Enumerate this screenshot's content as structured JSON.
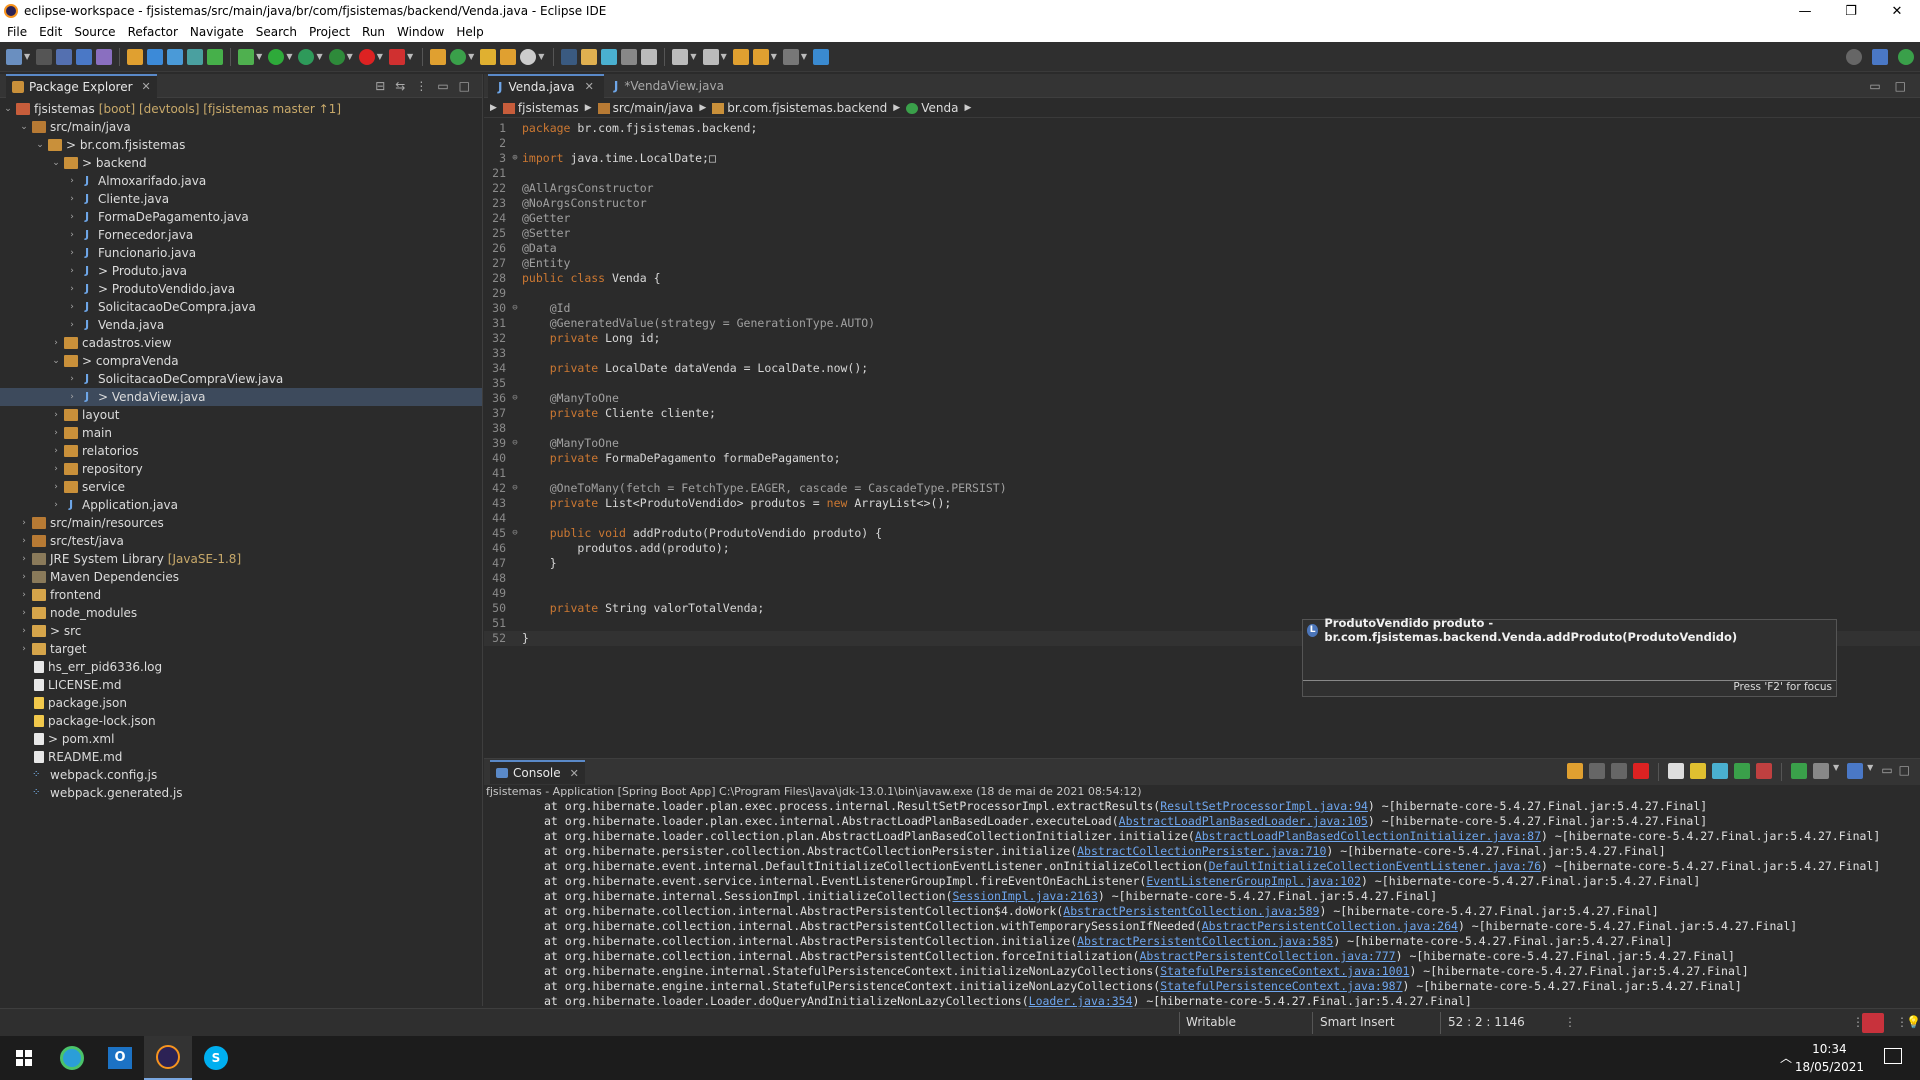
{
  "window": {
    "title": "eclipse-workspace - fjsistemas/src/main/java/br/com/fjsistemas/backend/Venda.java - Eclipse IDE"
  },
  "menu": [
    "File",
    "Edit",
    "Source",
    "Refactor",
    "Navigate",
    "Search",
    "Project",
    "Run",
    "Window",
    "Help"
  ],
  "explorer": {
    "tab_label": "Package Explorer",
    "items": [
      {
        "depth": 0,
        "twisty": "open",
        "icon": "project",
        "label": "fjsistemas",
        "deco": "[boot] [devtools] [fjsistemas master ↑1]"
      },
      {
        "depth": 1,
        "twisty": "open",
        "icon": "srcfolder",
        "label": "src/main/java",
        "deco": ""
      },
      {
        "depth": 2,
        "twisty": "open",
        "icon": "pkg",
        "label": "> br.com.fjsistemas",
        "deco": ""
      },
      {
        "depth": 3,
        "twisty": "open",
        "icon": "pkg",
        "label": "> backend",
        "deco": ""
      },
      {
        "depth": 4,
        "twisty": "closed",
        "icon": "java",
        "label": "Almoxarifado.java",
        "deco": ""
      },
      {
        "depth": 4,
        "twisty": "closed",
        "icon": "java",
        "label": "Cliente.java",
        "deco": ""
      },
      {
        "depth": 4,
        "twisty": "closed",
        "icon": "java",
        "label": "FormaDePagamento.java",
        "deco": ""
      },
      {
        "depth": 4,
        "twisty": "closed",
        "icon": "java",
        "label": "Fornecedor.java",
        "deco": ""
      },
      {
        "depth": 4,
        "twisty": "closed",
        "icon": "java",
        "label": "Funcionario.java",
        "deco": ""
      },
      {
        "depth": 4,
        "twisty": "closed",
        "icon": "java",
        "label": "> Produto.java",
        "deco": ""
      },
      {
        "depth": 4,
        "twisty": "closed",
        "icon": "java",
        "label": "> ProdutoVendido.java",
        "deco": ""
      },
      {
        "depth": 4,
        "twisty": "closed",
        "icon": "java",
        "label": "SolicitacaoDeCompra.java",
        "deco": ""
      },
      {
        "depth": 4,
        "twisty": "closed",
        "icon": "java",
        "label": "Venda.java",
        "deco": ""
      },
      {
        "depth": 3,
        "twisty": "closed",
        "icon": "pkg",
        "label": "cadastros.view",
        "deco": ""
      },
      {
        "depth": 3,
        "twisty": "open",
        "icon": "pkg",
        "label": "> compraVenda",
        "deco": ""
      },
      {
        "depth": 4,
        "twisty": "closed",
        "icon": "java",
        "label": "SolicitacaoDeCompraView.java",
        "deco": ""
      },
      {
        "depth": 4,
        "twisty": "closed",
        "icon": "java",
        "label": "> VendaView.java",
        "deco": "",
        "selected": true
      },
      {
        "depth": 3,
        "twisty": "closed",
        "icon": "pkg",
        "label": "layout",
        "deco": ""
      },
      {
        "depth": 3,
        "twisty": "closed",
        "icon": "pkg",
        "label": "main",
        "deco": ""
      },
      {
        "depth": 3,
        "twisty": "closed",
        "icon": "pkg",
        "label": "relatorios",
        "deco": ""
      },
      {
        "depth": 3,
        "twisty": "closed",
        "icon": "pkg",
        "label": "repository",
        "deco": ""
      },
      {
        "depth": 3,
        "twisty": "closed",
        "icon": "pkg",
        "label": "service",
        "deco": ""
      },
      {
        "depth": 3,
        "twisty": "closed",
        "icon": "java",
        "label": "Application.java",
        "deco": ""
      },
      {
        "depth": 1,
        "twisty": "closed",
        "icon": "srcfolder",
        "label": "src/main/resources",
        "deco": ""
      },
      {
        "depth": 1,
        "twisty": "closed",
        "icon": "srcfolder",
        "label": "src/test/java",
        "deco": ""
      },
      {
        "depth": 1,
        "twisty": "closed",
        "icon": "lib",
        "label": "JRE System Library",
        "deco": "[JavaSE-1.8]"
      },
      {
        "depth": 1,
        "twisty": "closed",
        "icon": "lib",
        "label": "Maven Dependencies",
        "deco": ""
      },
      {
        "depth": 1,
        "twisty": "closed",
        "icon": "folder",
        "label": "frontend",
        "deco": ""
      },
      {
        "depth": 1,
        "twisty": "closed",
        "icon": "folder",
        "label": "node_modules",
        "deco": ""
      },
      {
        "depth": 1,
        "twisty": "closed",
        "icon": "folder",
        "label": "> src",
        "deco": ""
      },
      {
        "depth": 1,
        "twisty": "closed",
        "icon": "folder",
        "label": "target",
        "deco": ""
      },
      {
        "depth": 1,
        "twisty": "none",
        "icon": "file",
        "label": "hs_err_pid6336.log",
        "deco": ""
      },
      {
        "depth": 1,
        "twisty": "none",
        "icon": "file",
        "label": "LICENSE.md",
        "deco": ""
      },
      {
        "depth": 1,
        "twisty": "none",
        "icon": "json",
        "label": "package.json",
        "deco": ""
      },
      {
        "depth": 1,
        "twisty": "none",
        "icon": "json",
        "label": "package-lock.json",
        "deco": ""
      },
      {
        "depth": 1,
        "twisty": "none",
        "icon": "file",
        "label": "> pom.xml",
        "deco": ""
      },
      {
        "depth": 1,
        "twisty": "none",
        "icon": "file",
        "label": "README.md",
        "deco": ""
      },
      {
        "depth": 1,
        "twisty": "none",
        "icon": "dots",
        "label": "webpack.config.js",
        "deco": ""
      },
      {
        "depth": 1,
        "twisty": "none",
        "icon": "dots",
        "label": "webpack.generated.js",
        "deco": ""
      }
    ]
  },
  "editor": {
    "tabs": [
      {
        "label": "Venda.java",
        "active": true
      },
      {
        "label": "*VendaView.java",
        "active": false
      }
    ],
    "breadcrumb": [
      "fjsistemas",
      "src/main/java",
      "br.com.fjsistemas.backend",
      "Venda"
    ],
    "lines": [
      {
        "n": "1",
        "fold": "",
        "text": "package br.com.fjsistemas.backend;"
      },
      {
        "n": "2",
        "fold": "",
        "text": ""
      },
      {
        "n": "3",
        "fold": "⊕",
        "text": "import java.time.LocalDate;□"
      },
      {
        "n": "21",
        "fold": "",
        "text": ""
      },
      {
        "n": "22",
        "fold": "",
        "text": "@AllArgsConstructor"
      },
      {
        "n": "23",
        "fold": "",
        "text": "@NoArgsConstructor"
      },
      {
        "n": "24",
        "fold": "",
        "text": "@Getter"
      },
      {
        "n": "25",
        "fold": "",
        "text": "@Setter"
      },
      {
        "n": "26",
        "fold": "",
        "text": "@Data"
      },
      {
        "n": "27",
        "fold": "",
        "text": "@Entity"
      },
      {
        "n": "28",
        "fold": "",
        "text": "public class Venda {"
      },
      {
        "n": "29",
        "fold": "",
        "text": ""
      },
      {
        "n": "30",
        "fold": "⊖",
        "text": "    @Id"
      },
      {
        "n": "31",
        "fold": "",
        "text": "    @GeneratedValue(strategy = GenerationType.AUTO)"
      },
      {
        "n": "32",
        "fold": "",
        "text": "    private Long id;"
      },
      {
        "n": "33",
        "fold": "",
        "text": ""
      },
      {
        "n": "34",
        "fold": "",
        "text": "    private LocalDate dataVenda = LocalDate.now();"
      },
      {
        "n": "35",
        "fold": "",
        "text": ""
      },
      {
        "n": "36",
        "fold": "⊖",
        "text": "    @ManyToOne"
      },
      {
        "n": "37",
        "fold": "",
        "text": "    private Cliente cliente;"
      },
      {
        "n": "38",
        "fold": "",
        "text": ""
      },
      {
        "n": "39",
        "fold": "⊖",
        "text": "    @ManyToOne"
      },
      {
        "n": "40",
        "fold": "",
        "text": "    private FormaDePagamento formaDePagamento;"
      },
      {
        "n": "41",
        "fold": "",
        "text": ""
      },
      {
        "n": "42",
        "fold": "⊖",
        "text": "    @OneToMany(fetch = FetchType.EAGER, cascade = CascadeType.PERSIST)"
      },
      {
        "n": "43",
        "fold": "",
        "text": "    private List<ProdutoVendido> produtos = new ArrayList<>();"
      },
      {
        "n": "44",
        "fold": "",
        "text": ""
      },
      {
        "n": "45",
        "fold": "⊖",
        "text": "    public void addProduto(ProdutoVendido produto) {"
      },
      {
        "n": "46",
        "fold": "",
        "text": "        produtos.add(produto);"
      },
      {
        "n": "47",
        "fold": "",
        "text": "    }"
      },
      {
        "n": "48",
        "fold": "",
        "text": ""
      },
      {
        "n": "49",
        "fold": "",
        "text": ""
      },
      {
        "n": "50",
        "fold": "",
        "text": "    private String valorTotalVenda;"
      },
      {
        "n": "51",
        "fold": "",
        "text": ""
      },
      {
        "n": "52",
        "fold": "",
        "text": "}"
      }
    ],
    "hover": {
      "title": "ProdutoVendido produto - br.com.fjsistemas.backend.Venda.addProduto(ProdutoVendido)",
      "footer": "Press 'F2' for focus"
    }
  },
  "console": {
    "tab_label": "Console",
    "description": "fjsistemas - Application [Spring Boot App] C:\\Program Files\\Java\\jdk-13.0.1\\bin\\javaw.exe  (18 de mai de 2021 08:54:12)",
    "lines": [
      {
        "pre": "at org.hibernate.loader.plan.exec.process.internal.ResultSetProcessorImpl.extractResults(",
        "link": "ResultSetProcessorImpl.java:94",
        "post": ") ~[hibernate-core-5.4.27.Final.jar:5.4.27.Final]"
      },
      {
        "pre": "at org.hibernate.loader.plan.exec.internal.AbstractLoadPlanBasedLoader.executeLoad(",
        "link": "AbstractLoadPlanBasedLoader.java:105",
        "post": ") ~[hibernate-core-5.4.27.Final.jar:5.4.27.Final]"
      },
      {
        "pre": "at org.hibernate.loader.collection.plan.AbstractLoadPlanBasedCollectionInitializer.initialize(",
        "link": "AbstractLoadPlanBasedCollectionInitializer.java:87",
        "post": ") ~[hibernate-core-5.4.27.Final.jar:5.4.27.Final]"
      },
      {
        "pre": "at org.hibernate.persister.collection.AbstractCollectionPersister.initialize(",
        "link": "AbstractCollectionPersister.java:710",
        "post": ") ~[hibernate-core-5.4.27.Final.jar:5.4.27.Final]"
      },
      {
        "pre": "at org.hibernate.event.internal.DefaultInitializeCollectionEventListener.onInitializeCollection(",
        "link": "DefaultInitializeCollectionEventListener.java:76",
        "post": ") ~[hibernate-core-5.4.27.Final.jar:5.4.27.Final]"
      },
      {
        "pre": "at org.hibernate.event.service.internal.EventListenerGroupImpl.fireEventOnEachListener(",
        "link": "EventListenerGroupImpl.java:102",
        "post": ") ~[hibernate-core-5.4.27.Final.jar:5.4.27.Final]"
      },
      {
        "pre": "at org.hibernate.internal.SessionImpl.initializeCollection(",
        "link": "SessionImpl.java:2163",
        "post": ") ~[hibernate-core-5.4.27.Final.jar:5.4.27.Final]"
      },
      {
        "pre": "at org.hibernate.collection.internal.AbstractPersistentCollection$4.doWork(",
        "link": "AbstractPersistentCollection.java:589",
        "post": ") ~[hibernate-core-5.4.27.Final.jar:5.4.27.Final]"
      },
      {
        "pre": "at org.hibernate.collection.internal.AbstractPersistentCollection.withTemporarySessionIfNeeded(",
        "link": "AbstractPersistentCollection.java:264",
        "post": ") ~[hibernate-core-5.4.27.Final.jar:5.4.27.Final]"
      },
      {
        "pre": "at org.hibernate.collection.internal.AbstractPersistentCollection.initialize(",
        "link": "AbstractPersistentCollection.java:585",
        "post": ") ~[hibernate-core-5.4.27.Final.jar:5.4.27.Final]"
      },
      {
        "pre": "at org.hibernate.collection.internal.AbstractPersistentCollection.forceInitialization(",
        "link": "AbstractPersistentCollection.java:777",
        "post": ") ~[hibernate-core-5.4.27.Final.jar:5.4.27.Final]"
      },
      {
        "pre": "at org.hibernate.engine.internal.StatefulPersistenceContext.initializeNonLazyCollections(",
        "link": "StatefulPersistenceContext.java:1001",
        "post": ") ~[hibernate-core-5.4.27.Final.jar:5.4.27.Final]"
      },
      {
        "pre": "at org.hibernate.engine.internal.StatefulPersistenceContext.initializeNonLazyCollections(",
        "link": "StatefulPersistenceContext.java:987",
        "post": ") ~[hibernate-core-5.4.27.Final.jar:5.4.27.Final]"
      },
      {
        "pre": "at org.hibernate.loader.Loader.doQueryAndInitializeNonLazyCollections(",
        "link": "Loader.java:354",
        "post": ") ~[hibernate-core-5.4.27.Final.jar:5.4.27.Final]"
      }
    ]
  },
  "status": {
    "writable": "Writable",
    "insert_mode": "Smart Insert",
    "position": "52 : 2 : 1146"
  },
  "taskbar": {
    "time": "10:34",
    "date": "18/05/2021"
  },
  "colors": {
    "accent": "#5a89c8",
    "keyword": "#cc7832",
    "link": "#6fa6ee",
    "background": "#2b2b2b"
  }
}
